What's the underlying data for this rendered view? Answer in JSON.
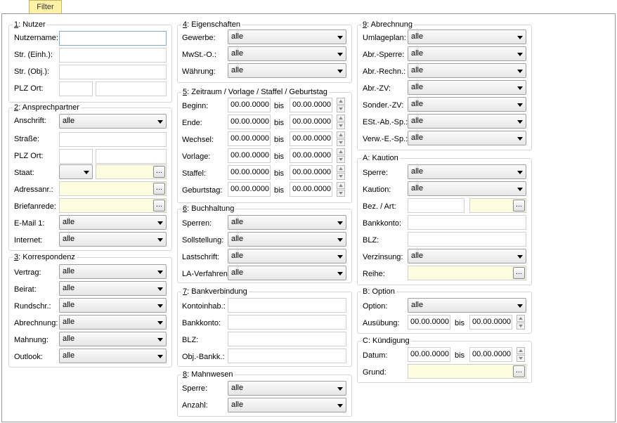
{
  "tab": {
    "label": "Filter"
  },
  "nutzer": {
    "num": "1",
    "title": ": Nutzer",
    "l_name": "Nutzername:",
    "l_str_einh": "Str. (Einh.):",
    "l_str_obj": "Str. (Obj.):",
    "l_plz": "PLZ Ort:"
  },
  "ansprech": {
    "num": "2",
    "title": ": Ansprechpartner",
    "l_anschrift": "Anschrift:",
    "anschrift": "alle",
    "l_strasse": "Straße:",
    "l_plz": "PLZ Ort:",
    "l_staat": "Staat:",
    "staat": "",
    "l_adressnr": "Adressanr.:",
    "l_brief": "Briefanrede:",
    "l_email": "E-Mail 1:",
    "email": "alle",
    "l_internet": "Internet:",
    "internet": "alle"
  },
  "korr": {
    "num": "3",
    "title": ": Korrespondenz",
    "items": [
      {
        "label": "Vertrag:",
        "value": "alle"
      },
      {
        "label": "Beirat:",
        "value": "alle"
      },
      {
        "label": "Rundschr.:",
        "value": "alle"
      },
      {
        "label": "Abrechnung:",
        "value": "alle"
      },
      {
        "label": "Mahnung:",
        "value": "alle"
      },
      {
        "label": "Outlook:",
        "value": "alle"
      }
    ]
  },
  "eig": {
    "num": "4",
    "title": ": Eigenschaften",
    "items": [
      {
        "label": "Gewerbe:",
        "value": "alle"
      },
      {
        "label": "MwSt.-O.:",
        "value": "alle"
      },
      {
        "label": "Währung:",
        "value": "alle"
      }
    ]
  },
  "zeit": {
    "num": "5",
    "title": ": Zeitraum / Vorlage / Staffel / Geburtstag",
    "bis": "bis",
    "rows": [
      {
        "label": "Beginn:",
        "from": "00.00.0000",
        "to": "00.00.0000"
      },
      {
        "label": "Ende:",
        "from": "00.00.0000",
        "to": "00.00.0000"
      },
      {
        "label": "Wechsel:",
        "from": "00.00.0000",
        "to": "00.00.0000"
      },
      {
        "label": "Vorlage:",
        "from": "00.00.0000",
        "to": "00.00.0000"
      },
      {
        "label": "Staffel:",
        "from": "00.00.0000",
        "to": "00.00.0000"
      },
      {
        "label": "Geburtstag:",
        "from": "00.00.0000",
        "to": "00.00.0000"
      }
    ]
  },
  "buch": {
    "num": "6",
    "title": ": Buchhaltung",
    "items": [
      {
        "label": "Sperren:",
        "value": "alle"
      },
      {
        "label": "Sollstellung:",
        "value": "alle"
      },
      {
        "label": "Lastschrift:",
        "value": "alle"
      },
      {
        "label": "LA-Verfahren:",
        "value": "alle"
      }
    ]
  },
  "bank": {
    "num": "7",
    "title": ": Bankverbindung",
    "items": [
      {
        "label": "Kontoinhab.:"
      },
      {
        "label": "Bankkonto:"
      },
      {
        "label": "BLZ:"
      },
      {
        "label": "Obj.-Bankk.:"
      }
    ]
  },
  "mahn": {
    "num": "8",
    "title": ": Mahnwesen",
    "items": [
      {
        "label": "Sperre:",
        "value": "alle"
      },
      {
        "label": "Anzahl:",
        "value": "alle"
      }
    ]
  },
  "abr": {
    "num": "9",
    "title": ": Abrechnung",
    "items": [
      {
        "label": "Umlageplan:",
        "value": "alle"
      },
      {
        "label": "Abr.-Sperre:",
        "value": "alle"
      },
      {
        "label": "Abr.-Rechn.:",
        "value": "alle"
      },
      {
        "label": "Abr.-ZV:",
        "value": "alle"
      },
      {
        "label": "Sonder.-ZV:",
        "value": "alle"
      },
      {
        "label": "ESt.-Ab.-Sp.:",
        "value": "alle"
      },
      {
        "label": "Verw.-E.-Sp.:",
        "value": "alle"
      }
    ]
  },
  "kaution": {
    "title": "A: Kaution",
    "l_sperre": "Sperre:",
    "sperre": "alle",
    "l_kaution": "Kaution:",
    "kaution": "alle",
    "l_bez": "Bez. / Art:",
    "l_bankkonto": "Bankkonto:",
    "l_blz": "BLZ:",
    "l_verz": "Verzinsung:",
    "verz": "alle",
    "l_reihe": "Reihe:"
  },
  "option": {
    "title": "B: Option",
    "l_option": "Option:",
    "option": "alle",
    "l_ausuebung": "Ausübung:",
    "from": "00.00.0000",
    "bis": "bis",
    "to": "00.00.0000"
  },
  "kuend": {
    "title": "C: Kündigung",
    "l_datum": "Datum:",
    "from": "00.00.0000",
    "bis": "bis",
    "to": "00.00.0000",
    "l_grund": "Grund:"
  },
  "dots_label": "..."
}
